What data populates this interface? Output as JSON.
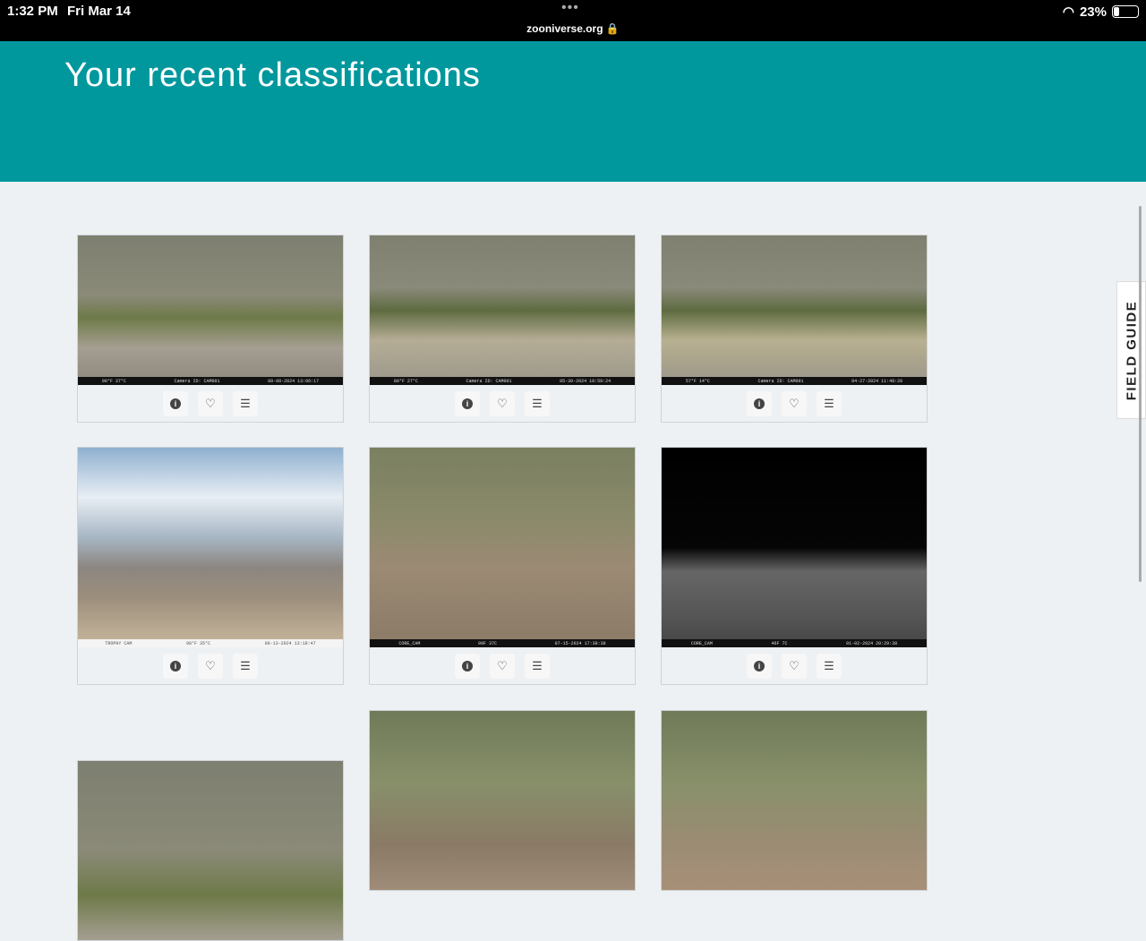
{
  "status_bar": {
    "time": "1:32 PM",
    "date": "Fri Mar 14",
    "url": "zooniverse.org 🔒",
    "battery": "23%",
    "battery_level": 0.23
  },
  "banner": {
    "title": "Your recent classifications"
  },
  "field_guide": "FIELD GUIDE",
  "actions": {
    "info": "i",
    "favorite": "♡",
    "collect": "☰"
  },
  "cards": [
    {
      "caption": [
        "98°F 37°C",
        "Camera ID: CAM001",
        "08-08-2024 13:06:17"
      ],
      "scene": "desert hillside"
    },
    {
      "caption": [
        "80°F 27°C",
        "Camera ID: CAM001",
        "05-30-2024 10:59:24"
      ],
      "scene": "desert hillside with water trough"
    },
    {
      "caption": [
        "57°F 14°C",
        "Camera ID: CAM001",
        "04-27-2024 11:48:20"
      ],
      "scene": "desert hillside with water trough"
    },
    {
      "caption": [
        "TROPHY CAM",
        "98°F 35°C",
        "08-13-2024 13:18:47"
      ],
      "scene": "bighorn sheep on ridge under sky"
    },
    {
      "caption": [
        "CORE_CAM",
        "99F 37C",
        "07-15-2024 17:38:38"
      ],
      "scene": "bighorn sheep on slope"
    },
    {
      "caption": [
        "CORE_CAM",
        "46F 7C",
        "01-02-2024 20:29:38"
      ],
      "scene": "night infrared"
    },
    {
      "caption": [],
      "scene": "desert hillside"
    },
    {
      "caption": [],
      "scene": "bighorn sheep group"
    },
    {
      "caption": [],
      "scene": "bighorn sheep on slope"
    }
  ]
}
